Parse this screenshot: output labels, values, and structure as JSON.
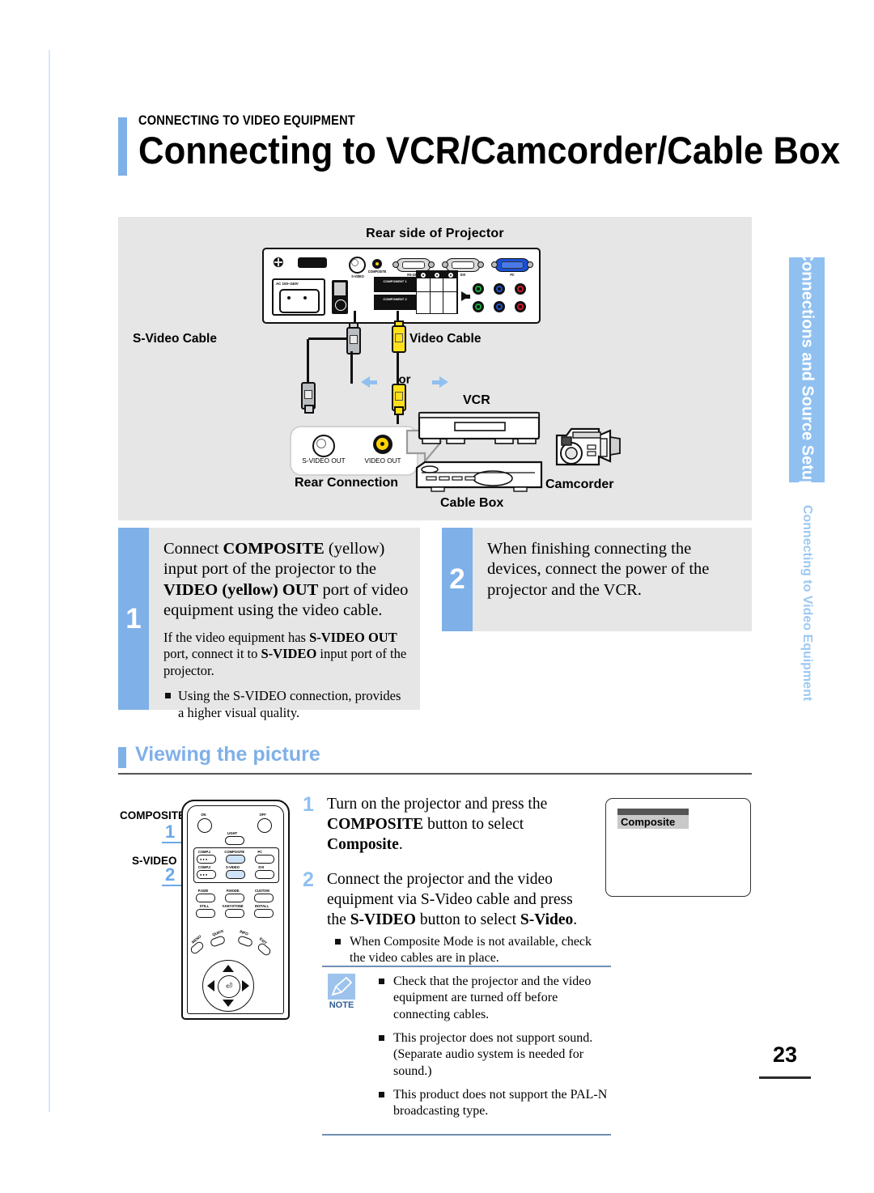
{
  "header": {
    "kicker": "CONNECTING TO VIDEO EQUIPMENT",
    "title": "Connecting to VCR/Camcorder/Cable Box"
  },
  "side_tabs": {
    "chapter": "Connections and Source Setup",
    "section": "Connecting to Video Equipment"
  },
  "diagram": {
    "title": "Rear side of Projector",
    "projector_ports": [
      "S-VIDEO",
      "COMPOSITE",
      "RS-232C",
      "DVI",
      "PC"
    ],
    "ac_label": "AC 100~240V",
    "component_rows": [
      "COMPONENT 1",
      "COMPONENT 2"
    ],
    "cable_labels": {
      "svideo": "S-Video Cable",
      "video": "Video Cable",
      "or": "or"
    },
    "rear_connection": {
      "title": "Rear Connection",
      "jacks": [
        "S-VIDEO OUT",
        "VIDEO OUT"
      ]
    },
    "devices": {
      "vcr": "VCR",
      "cable_box": "Cable Box",
      "camcorder": "Camcorder"
    }
  },
  "steps": [
    {
      "number": "1",
      "main_parts": [
        {
          "text": "Connect ",
          "bold": false
        },
        {
          "text": "COMPOSITE",
          "bold": true
        },
        {
          "text": " (yellow) input port of the projector to the ",
          "bold": false
        },
        {
          "text": "VIDEO (yellow) OUT",
          "bold": true
        },
        {
          "text": " port of video equipment using the video cable.",
          "bold": false
        }
      ],
      "sub_parts": [
        {
          "text": "If the video equipment has ",
          "bold": false
        },
        {
          "text": "S-VIDEO OUT",
          "bold": true
        },
        {
          "text": " port, connect it to ",
          "bold": false
        },
        {
          "text": "S-VIDEO",
          "bold": true
        },
        {
          "text": " input port of the projector.",
          "bold": false
        }
      ],
      "bullet": "Using the S-VIDEO connection, provides a higher visual quality."
    },
    {
      "number": "2",
      "main_parts": [
        {
          "text": "When finishing connecting the devices, connect the power of the projector and the VCR.",
          "bold": false
        }
      ]
    }
  ],
  "viewing": {
    "heading": "Viewing the picture",
    "remote": {
      "callouts": [
        {
          "label": "COMPOSITE",
          "number": "1"
        },
        {
          "label": "S-VIDEO",
          "number": "2"
        }
      ],
      "top_buttons": [
        "ON",
        "OFF",
        "LIGHT"
      ],
      "source_buttons": [
        "COMP.1",
        "COMPOSITE",
        "PC",
        "COMP.2",
        "S-VIDEO",
        "DVI"
      ],
      "function_buttons": [
        "P.SIZE",
        "P.MODE",
        "CUSTOM",
        "STILL",
        "V.KEYSTONE",
        "INSTALL"
      ],
      "nav_buttons": [
        "MENU",
        "QUICK",
        "INFO",
        "EXIT"
      ]
    },
    "instructions": [
      {
        "number": "1",
        "parts": [
          {
            "text": "Turn on the projector and press the ",
            "bold": false
          },
          {
            "text": "COMPOSITE",
            "bold": true
          },
          {
            "text": " button to select ",
            "bold": false
          },
          {
            "text": "Composite",
            "bold": true
          },
          {
            "text": ".",
            "bold": false
          }
        ]
      },
      {
        "number": "2",
        "parts": [
          {
            "text": "Connect the projector and the video equipment via S-Video cable and press the ",
            "bold": false
          },
          {
            "text": "S-VIDEO",
            "bold": true
          },
          {
            "text": " button to select ",
            "bold": false
          },
          {
            "text": "S-Video",
            "bold": true
          },
          {
            "text": ".",
            "bold": false
          }
        ],
        "bullet": "When Composite Mode is not available, check the video cables are in place."
      }
    ],
    "osd_label": "Composite"
  },
  "note": {
    "label": "NOTE",
    "items": [
      "Check that the projector and the video equipment are turned off before connecting cables.",
      "This projector does not support sound. (Separate audio system is needed for sound.)",
      "This product does not support the PAL-N broadcasting type."
    ]
  },
  "page_number": "23",
  "colors": {
    "accent_blue": "#7fb0e8",
    "light_blue": "#8fc0f0",
    "panel_gray": "#e6e6e6",
    "yellow": "#ffd400"
  }
}
